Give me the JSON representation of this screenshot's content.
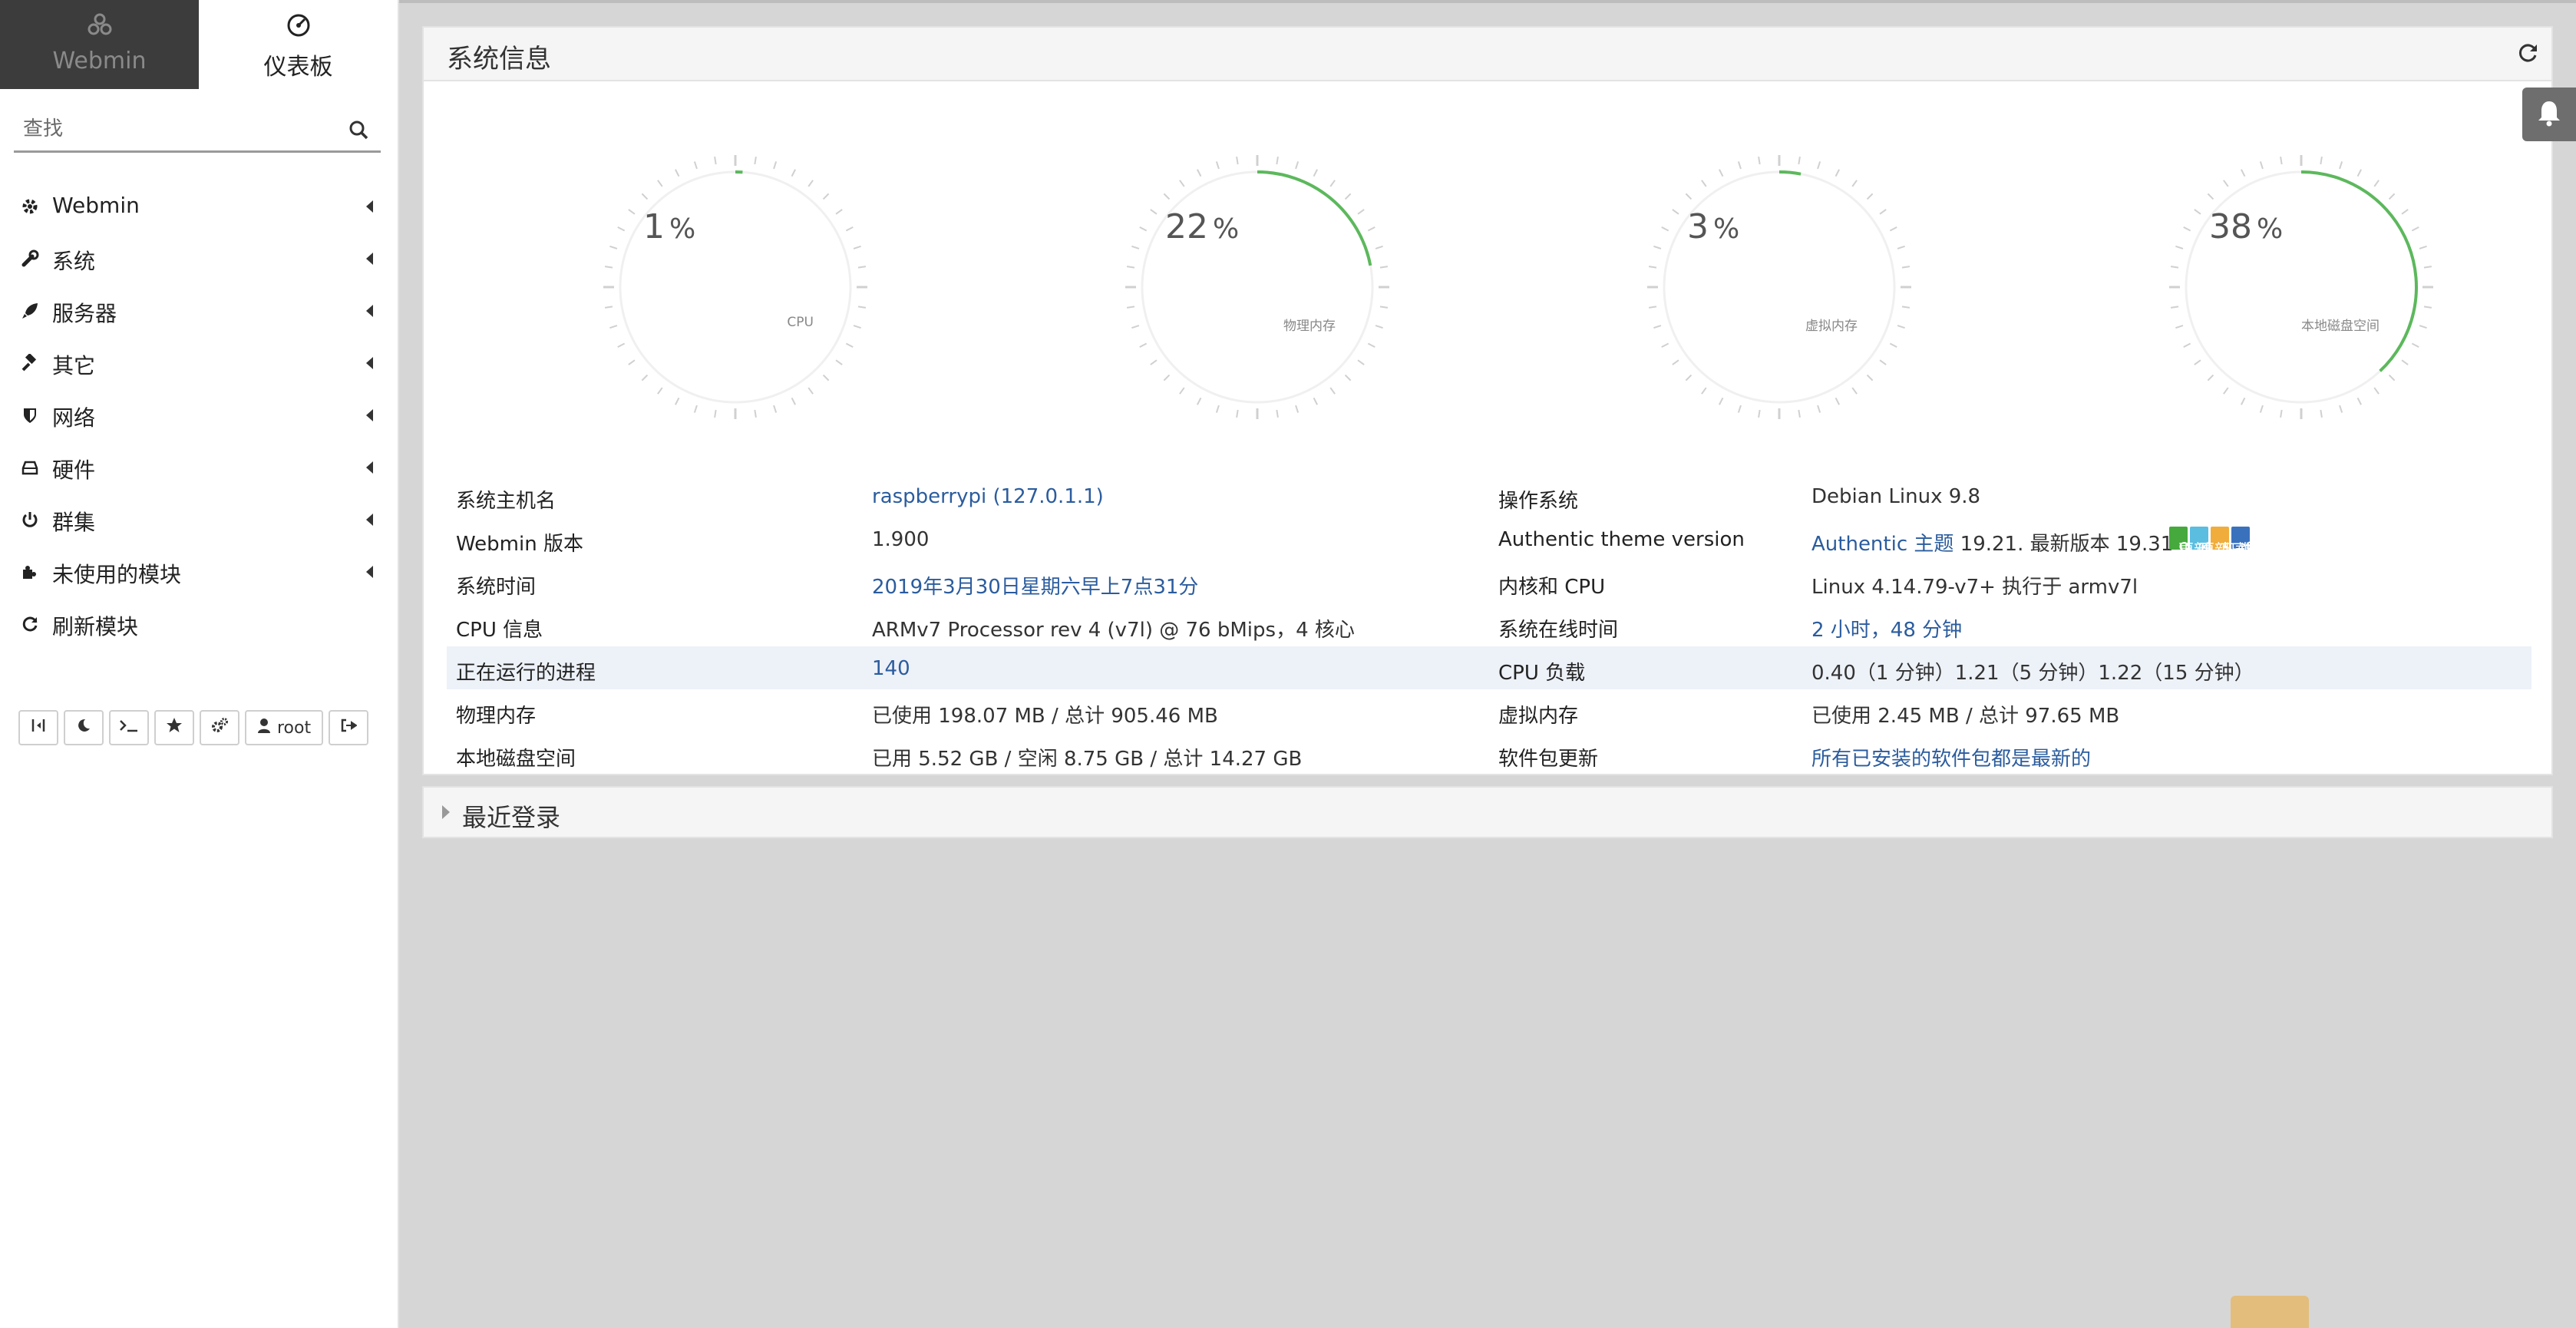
{
  "sidebar": {
    "tabs": [
      {
        "label": "Webmin",
        "icon": "webmin-logo-icon"
      },
      {
        "label": "仪表板",
        "icon": "dashboard-icon"
      }
    ],
    "search": {
      "placeholder": "查找",
      "value": ""
    },
    "items": [
      {
        "label": "Webmin",
        "icon": "gear-icon"
      },
      {
        "label": "系统",
        "icon": "wrench-icon"
      },
      {
        "label": "服务器",
        "icon": "rocket-icon"
      },
      {
        "label": "其它",
        "icon": "gavel-icon"
      },
      {
        "label": "网络",
        "icon": "shield-icon"
      },
      {
        "label": "硬件",
        "icon": "hdd-icon"
      },
      {
        "label": "群集",
        "icon": "power-icon"
      },
      {
        "label": "未使用的模块",
        "icon": "puzzle-icon"
      },
      {
        "label": "刷新模块",
        "icon": "refresh-icon"
      }
    ],
    "toolbar": {
      "buttons": [
        "collapse-icon",
        "moon-icon",
        "terminal-icon",
        "star-icon",
        "cogs-icon",
        "user-icon",
        "logout-icon"
      ],
      "user_label": "root"
    }
  },
  "main": {
    "panel_title": "系统信息",
    "gauges": [
      {
        "value": "1",
        "unit": "%",
        "label": "CPU",
        "fraction": 0.01,
        "color": "#5cb85c"
      },
      {
        "value": "22",
        "unit": "%",
        "label": "物理内存",
        "fraction": 0.22,
        "color": "#5cb85c"
      },
      {
        "value": "3",
        "unit": "%",
        "label": "虚拟内存",
        "fraction": 0.03,
        "color": "#5cb85c"
      },
      {
        "value": "38",
        "unit": "%",
        "label": "本地磁盘空间",
        "fraction": 0.38,
        "color": "#5cb85c"
      }
    ],
    "info_rows": [
      {
        "k1": "系统主机名",
        "v1": "raspberrypi (127.0.1.1)",
        "k2": "操作系统",
        "v2": "Debian Linux 9.8"
      },
      {
        "k1": "Webmin 版本",
        "v1": "1.900",
        "k2": "Authentic theme version",
        "v2_link": "Authentic 主题",
        "v2_rest": " 19.21. 最新版本 19.31"
      },
      {
        "k1": "系统时间",
        "v1": "2019年3月30日星期六早上7点31分",
        "k2": "内核和 CPU",
        "v2": "Linux 4.14.79-v7+ 执行于 armv7l"
      },
      {
        "k1": "CPU 信息",
        "v1": "ARMv7 Processor rev 4 (v7l) @ 76 bMips，4 核心",
        "k2": "系统在线时间",
        "v2": "2 小时，48 分钟"
      },
      {
        "k1": "正在运行的进程",
        "v1": "140",
        "k2": "CPU 负载",
        "v2": "0.40（1 分钟）1.21（5 分钟）1.22（15 分钟）"
      },
      {
        "k1": "物理内存",
        "v1": "已使用 198.07 MB / 总计 905.46 MB",
        "k2": "虚拟内存",
        "v2": "已使用 2.45 MB / 总计 97.65 MB"
      },
      {
        "k1": "本地磁盘空间",
        "v1": "已用 5.52 GB / 空闲 8.75 GB / 总计 14.27 GB",
        "k2": "软件包更新",
        "v2": "所有已安装的软件包都是最新的"
      }
    ],
    "theme_buttons": [
      {
        "label": "更新",
        "icon": "refresh-icon"
      },
      {
        "label": "更新日志",
        "icon": "edit-icon"
      },
      {
        "label": "下载",
        "icon": "download-icon"
      },
      {
        "label": "选项",
        "icon": "cogs-icon"
      }
    ],
    "recent_logins_title": "最近登录"
  },
  "colors": {
    "accent_link": "#2b5c9e",
    "gauge_fill": "#5cb85c",
    "highlight_row": "#edf1f8",
    "sidebar_dark": "#3c3c3c"
  }
}
